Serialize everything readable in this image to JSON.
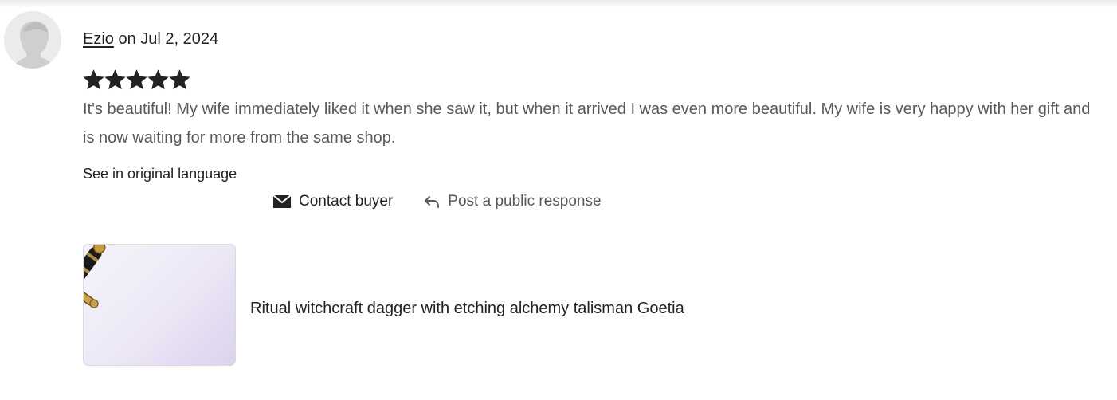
{
  "review": {
    "reviewer_name": "Ezio",
    "date_text": " on Jul 2, 2024",
    "rating": 5,
    "rating_max": 5,
    "text": "It's beautiful! My wife immediately liked it when she saw it, but when it arrived I was even more beautiful. My wife is very happy with her gift and is now waiting for more from the same shop.",
    "translate_label": "See in original language"
  },
  "actions": {
    "contact_label": "Contact buyer",
    "respond_label": "Post a public response"
  },
  "product": {
    "title": "Ritual witchcraft dagger with etching alchemy talisman Goetia"
  },
  "icons": {
    "avatar": "user-silhouette-icon",
    "star": "star-icon",
    "contact": "envelope-icon",
    "respond": "reply-arrow-icon"
  },
  "colors": {
    "text_primary": "#222222",
    "text_secondary": "#595959",
    "star": "#222222"
  }
}
